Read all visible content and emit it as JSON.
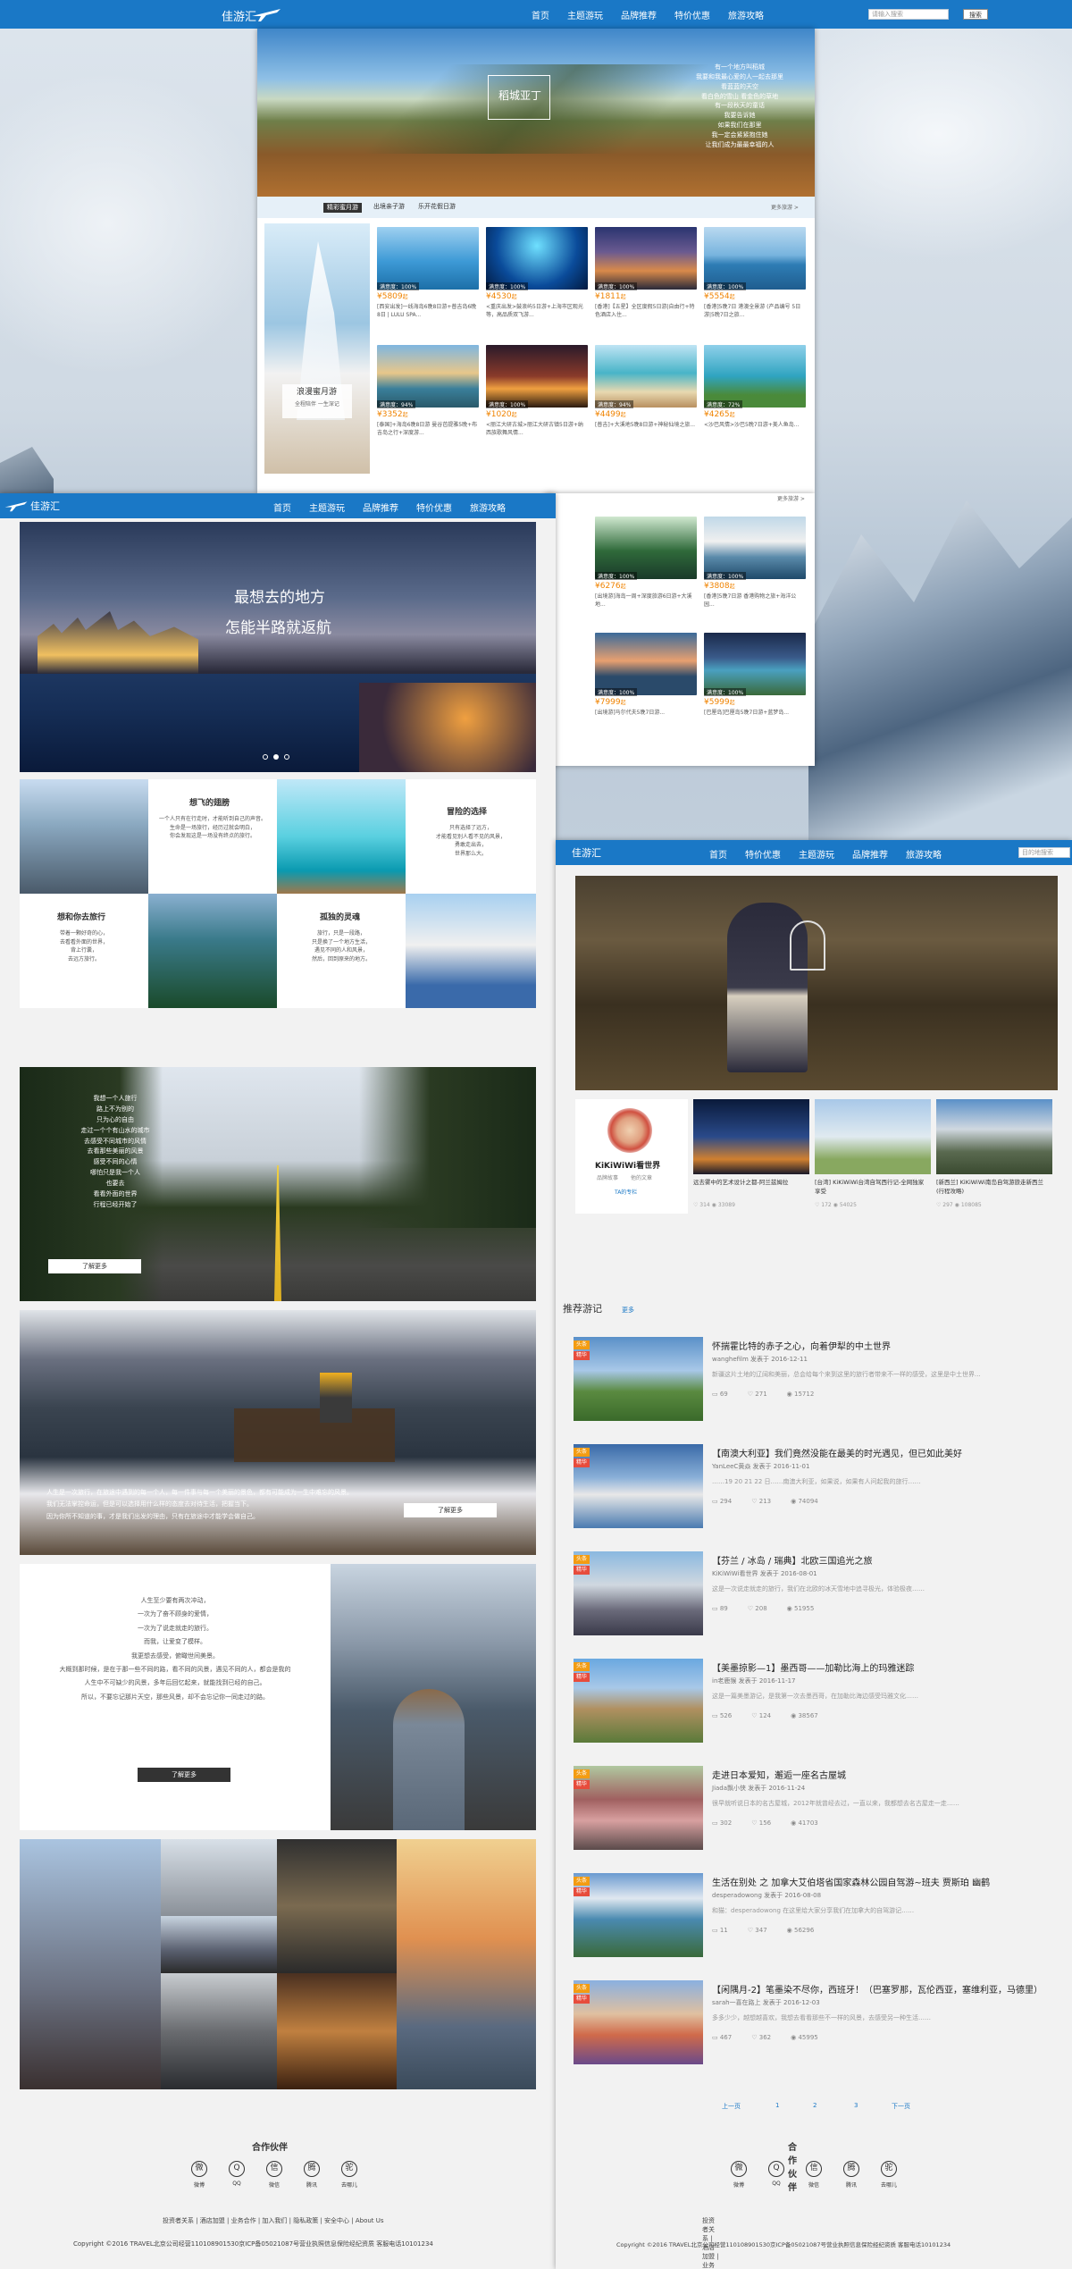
{
  "top_nav": {
    "logo": "佳游汇",
    "items": [
      "首页",
      "主题游玩",
      "品牌推荐",
      "特价优惠",
      "旅游攻略"
    ],
    "search_placeholder": "请输入搜索",
    "search_btn": "搜索"
  },
  "hero_top": {
    "title": "稻城亚丁",
    "poem": [
      "有一个地方叫稻城",
      "我要和我最心爱的人一起去那里",
      "看蓝蓝的天空",
      "看白色的雪山 看金色的草地",
      "有一段秋天的童话",
      "我要告诉她",
      "如果我们在那里",
      "我一定会紧紧抱住她",
      "让我们成为最最幸福的人"
    ]
  },
  "tabs": {
    "items": [
      "精彩蜜月游",
      "出境亲子游",
      "乐开花假日游"
    ],
    "more": "更多旅游 >"
  },
  "honeymoon": {
    "title": "浪漫蜜月游",
    "sub": "全程陪伴 一生深记"
  },
  "cards_row1": [
    {
      "sat": "满意度：100%",
      "price": "¥5809",
      "unit": "起",
      "desc": "[西安出发]一线海岛6晚8日游+普吉岛6晚8日 | LULU SPA..."
    },
    {
      "sat": "满意度：100%",
      "price": "¥4530",
      "unit": "起",
      "desc": "<重庆出发>鼓浪屿5日游+上海市区观光等，高品质双飞游..."
    },
    {
      "sat": "满意度：100%",
      "price": "¥1811",
      "unit": "起",
      "desc": "[香港]【五星】全区度假5日游|自由行+特色酒店入住..."
    },
    {
      "sat": "满意度：100%",
      "price": "¥5554",
      "unit": "起",
      "desc": "[香港]5晚7日 港澳全景游 (产品编号 5日游|5晚7日之旅..."
    }
  ],
  "cards_row2": [
    {
      "sat": "满意度：94%",
      "price": "¥3352",
      "unit": "起",
      "desc": "[泰国]+海岛6晚8日游 曼谷芭提雅5晚+布吉岛之行+深度游..."
    },
    {
      "sat": "满意度：100%",
      "price": "¥1020",
      "unit": "起",
      "desc": "<丽江大研古城>丽江大研古镇5日游+纳西族歌舞风情..."
    },
    {
      "sat": "满意度：94%",
      "price": "¥4499",
      "unit": "起",
      "desc": "[普吉]+大溪地5晚8日游+神秘仙境之旅..."
    },
    {
      "sat": "满意度：72%",
      "price": "¥4265",
      "unit": "起",
      "desc": "<沙巴风情>沙巴5晚7日游+美人鱼岛..."
    }
  ],
  "section2_more": "更多旅游 >",
  "cards_row3": [
    {
      "sat": "满意度：100%",
      "price": "¥6276",
      "unit": "起",
      "desc": "[出境游]海岛一周+深度旅游6日游+大溪地..."
    },
    {
      "sat": "满意度：100%",
      "price": "¥3808",
      "unit": "起",
      "desc": "[香港]5晚7日游 香港购物之旅+海洋公园..."
    }
  ],
  "cards_row4": [
    {
      "sat": "满意度：100%",
      "price": "¥7999",
      "unit": "起",
      "desc": "[出境游]马尔代夫5晚7日游..."
    },
    {
      "sat": "满意度：100%",
      "price": "¥5999",
      "unit": "起",
      "desc": "[巴厘岛]巴厘岛5晚7日游+蓝梦岛..."
    }
  ],
  "left_page": {
    "logo": "佳游汇",
    "nav": [
      "首页",
      "主题游玩",
      "品牌推荐",
      "特价优惠",
      "旅游攻略"
    ],
    "slogan1": "最想去的地方",
    "slogan2": "怎能半路就返航",
    "grid": [
      {
        "t": "想飞的翅膀",
        "d": "一个人只有在行走时，才能听到自己的声音。\n生命是一场旅行，经历过就会明白，\n你会发现这是一场没有终点的旅行。"
      },
      {
        "t": "冒险的选择",
        "d": "只有选择了远方，\n才能看见别人看不见的风景，\n勇敢走出去，\n世界那么大。"
      },
      {
        "t": "想和你去旅行",
        "d": "带着一颗好奇的心，\n去看看外面的世界，\n背上行囊，\n去远方旅行。"
      },
      {
        "t": "孤独的灵魂",
        "d": "旅行，只是一段路，\n只是换了一个地方生活，\n遇见不同的人和风景，\n然后，回到原来的地方。"
      }
    ],
    "road_poem": [
      "我想一个人旅行",
      "路上不为别的",
      "只为心的自由",
      "走过一个个有山水的城市",
      "去感受不同城市的风情",
      "去看那些美丽的风景",
      "感受不同的心情",
      "哪怕只是我一个人",
      "也要去",
      "看看外面的世界",
      "行程已经开始了"
    ],
    "road_btn": "了解更多",
    "bench_text": [
      "人生是一次旅行，在旅途中遇到的每一个人，每一件事与每一个美丽的景色，都有可能成为一生中难忘的风景。",
      "我们无法掌控命运，但是可以选择用什么样的态度去对待生活，把握当下。",
      "因为你所不知道的事，才是我们出发的理由，只有在旅途中才能学会做自己。"
    ],
    "bench_btn": "了解更多",
    "quote": [
      "人生至少要有两次冲动，",
      "一次为了奋不顾身的爱情，",
      "一次为了说走就走的旅行。",
      "而我，让爱变了模样。",
      "我更想去感受，俯瞰世间美景。",
      "大概到那时候，是在于那一些不同的路，看不同的风景，遇见不同的人，都会是我的",
      "人生中不可缺少的风景，多年后回忆起来，就能找到已经的自己。",
      "所以，不要忘记那片天空，那些风景，却不会忘记你一同走过的路。"
    ],
    "quote_btn": "了解更多"
  },
  "right_page": {
    "logo": "佳游汇",
    "nav": [
      "首页",
      "特价优惠",
      "主题游玩",
      "品牌推荐",
      "旅游攻略"
    ],
    "search_placeholder": "目的地搜索",
    "profile_name": "KiKiWiWi看世界",
    "profile_sub1": "品牌故事",
    "profile_sub2": "他的文章",
    "profile_link": "TA的专栏",
    "feature": [
      {
        "title": "远去雾中的艺术设计之都-阿兰兹姆拉",
        "likes": "314",
        "views": "33089"
      },
      {
        "title": "[台湾] KiKiWiWi台湾自驾西行记-全网独家享受",
        "likes": "172",
        "views": "54025"
      },
      {
        "title": "[新西兰] KiKiWiWi南岛自驾游旅走新西兰 (行程攻略)",
        "likes": "297",
        "views": "108085"
      }
    ],
    "rec_title": "推荐游记",
    "rec_more": "更多",
    "tag1": "头条",
    "tag2": "精华",
    "blogs": [
      {
        "title": "怀揣霍比特的赤子之心，向着伊犁的中土世界",
        "meta": "wanghefilm  发表于 2016-12-11",
        "desc": "新疆这片土地的辽阔和美丽，总会给每个来到这里的旅行者带来不一样的感受，这里是中土世界...",
        "a": "69",
        "b": "271",
        "c": "15712"
      },
      {
        "title": "【南澳大利亚】我们竟然没能在最美的时光遇见，但已如此美好",
        "meta": "YanLeeC黄焱  发表于 2016-11-01",
        "desc": "……19 20 21 22 日……南澳大利亚，如果说，如果有人问起我的旅行……",
        "a": "294",
        "b": "213",
        "c": "74094"
      },
      {
        "title": "【芬兰 / 冰岛 / 瑞典】北欧三国追光之旅",
        "meta": "KiKiWiWi看世界  发表于 2016-08-01",
        "desc": "这是一次说走就走的旅行，我们在北欧的冰天雪地中追寻极光，体验极夜……",
        "a": "89",
        "b": "208",
        "c": "51955"
      },
      {
        "title": "【美墨掠影—1】墨西哥——加勒比海上的玛雅迷踪",
        "meta": "in老鹿猴  发表于 2016-11-17",
        "desc": "这是一篇美墨游记，是我第一次去墨西哥，在加勒比海边感受玛雅文化……",
        "a": "526",
        "b": "124",
        "c": "38567"
      },
      {
        "title": "走进日本爱知，邂逅一座名古屋城",
        "meta": "Jiada飘小侠  发表于 2016-11-24",
        "desc": "很早就听说日本的名古屋城，2012年就曾经去过，一直以来，我都想去名古屋走一走……",
        "a": "302",
        "b": "156",
        "c": "41703"
      },
      {
        "title": "生活在别处 之 加拿大艾伯塔省国家森林公园自驾游~班夫 贾斯珀 幽鹤",
        "meta": "desperadowong  发表于 2016-08-08",
        "desc": "和猫：desperadowong 在这里给大家分享我们在加拿大的自驾游记……",
        "a": "11",
        "b": "347",
        "c": "56296"
      },
      {
        "title": "【闲隅月-2】笔墨染不尽你，西班牙！（巴塞罗那，瓦伦西亚，塞维利亚，马德里）",
        "meta": "sarah一喜在路上  发表于 2016-12-03",
        "desc": "多多少少，越想越喜欢，我想去看看那些不一样的风景，去感受另一种生活……",
        "a": "467",
        "b": "362",
        "c": "45995"
      }
    ],
    "pager": [
      "上一页",
      "1",
      "2",
      "3",
      "下一页"
    ]
  },
  "footer": {
    "partners": "合作伙伴",
    "icons": [
      {
        "icon": "weibo-icon",
        "label": "微博"
      },
      {
        "icon": "qq-icon",
        "label": "QQ"
      },
      {
        "icon": "wechat-icon",
        "label": "微信"
      },
      {
        "icon": "renren-icon",
        "label": "腾讯"
      },
      {
        "icon": "camel-icon",
        "label": "去哪儿"
      }
    ],
    "links": "投资者关系 | 酒店加盟 | 业务合作 | 加入我们 | 隐私政策 | 安全中心 | About Us",
    "copyright": "Copyright ©2016 TRAVEL北京公司经营110108901530京ICP备05021087号营业执照信息保险经纪资质 客服电话10101234"
  },
  "colors": {
    "primary": "#1a78c6",
    "orange": "#f08300"
  }
}
